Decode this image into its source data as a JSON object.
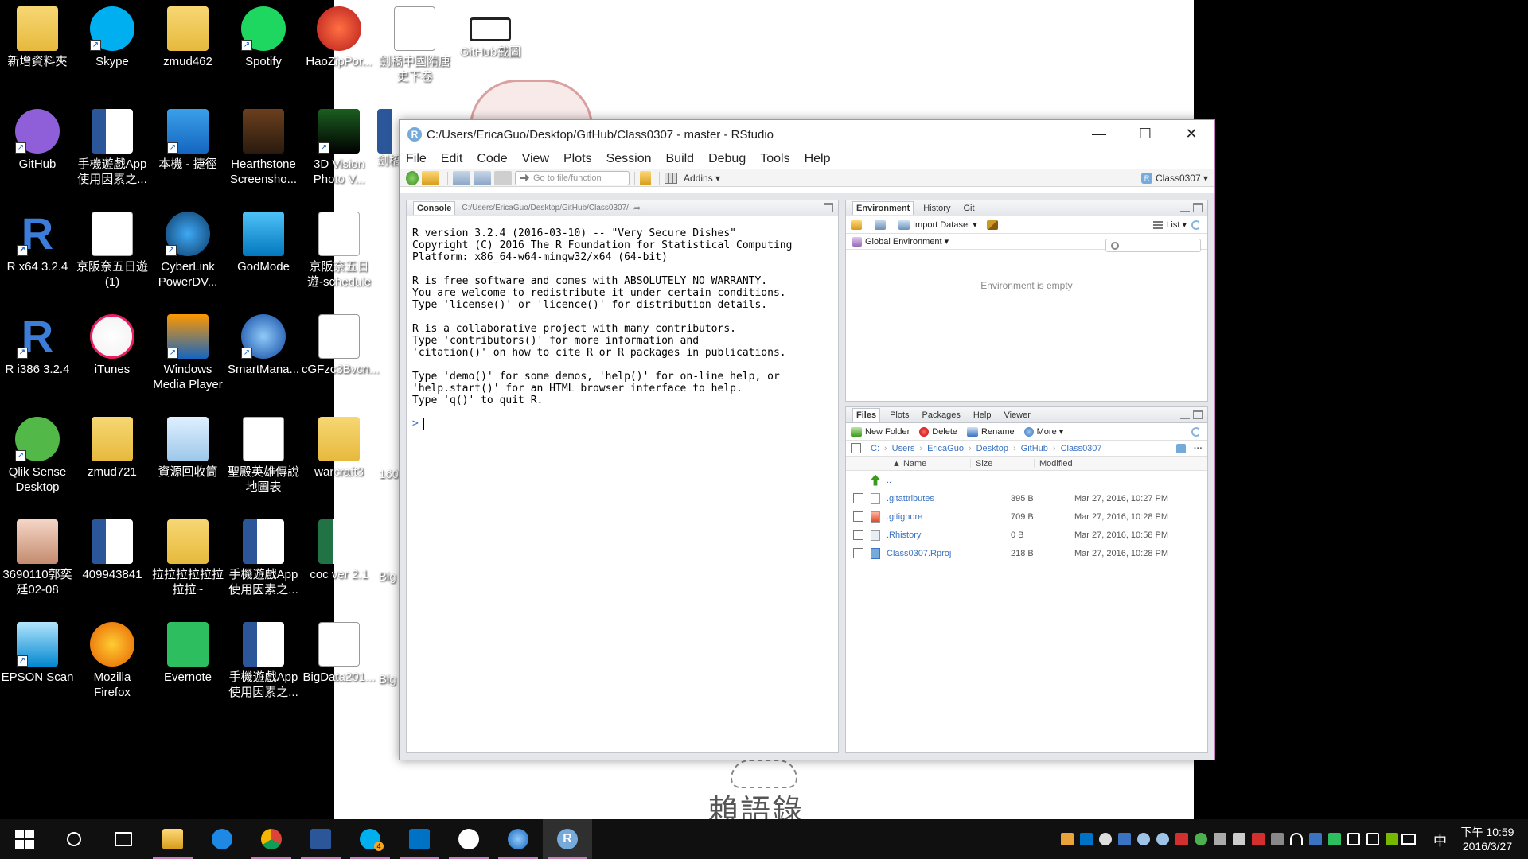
{
  "desktop": {
    "icons": [
      {
        "label": "新增資料夾",
        "icon": "folder-icon"
      },
      {
        "label": "Skype",
        "icon": "skype-icon"
      },
      {
        "label": "zmud462",
        "icon": "folder-icon"
      },
      {
        "label": "Spotify",
        "icon": "spotify-icon"
      },
      {
        "label": "HaoZipPor...",
        "icon": "haozip-icon"
      },
      {
        "label": "劍橋中國隋唐史下卷",
        "icon": "pdf-icon"
      },
      {
        "label": "GitHub截圖",
        "icon": "screenshot-icon"
      },
      {
        "label": "GitHub",
        "icon": "github-icon"
      },
      {
        "label": "手機遊戲App使用因素之...",
        "icon": "word-icon"
      },
      {
        "label": "本機 - 捷徑",
        "icon": "this-pc-icon"
      },
      {
        "label": "Hearthstone Screensho...",
        "icon": "hearthstone-icon"
      },
      {
        "label": "3D Vision Photo V...",
        "icon": "3d-vision-icon"
      },
      {
        "label": "R x64 3.2.4",
        "icon": "r-icon"
      },
      {
        "label": "京阪奈五日遊 (1)",
        "icon": "document-icon"
      },
      {
        "label": "CyberLink PowerDV...",
        "icon": "cyberlink-icon"
      },
      {
        "label": "GodMode",
        "icon": "godmode-icon"
      },
      {
        "label": "京阪奈五日遊-schedule",
        "icon": "word-icon"
      },
      {
        "label": "R i386 3.2.4",
        "icon": "r-icon"
      },
      {
        "label": "iTunes",
        "icon": "itunes-icon"
      },
      {
        "label": "Windows Media Player",
        "icon": "wmp-icon"
      },
      {
        "label": "SmartMana...",
        "icon": "smartmanager-icon"
      },
      {
        "label": "cGFzc3Bvcn...",
        "icon": "pdf-icon"
      },
      {
        "label": "Qlik Sense Desktop",
        "icon": "qlik-icon"
      },
      {
        "label": "zmud721",
        "icon": "folder-icon"
      },
      {
        "label": "資源回收筒",
        "icon": "recycle-bin-icon"
      },
      {
        "label": "聖殿英雄傳說地圖表",
        "icon": "document-icon"
      },
      {
        "label": "warcraft3",
        "icon": "folder-icon"
      },
      {
        "label": "3690110郭奕廷02-08",
        "icon": "photo-icon"
      },
      {
        "label": "409943841",
        "icon": "word-icon"
      },
      {
        "label": "拉拉拉拉拉拉拉拉~",
        "icon": "folder-icon"
      },
      {
        "label": "手機遊戲App使用因素之...",
        "icon": "word-icon"
      },
      {
        "label": "coc ver 2.1",
        "icon": "excel-icon"
      },
      {
        "label": "EPSON Scan",
        "icon": "epson-icon"
      },
      {
        "label": "Mozilla Firefox",
        "icon": "firefox-icon"
      },
      {
        "label": "Evernote",
        "icon": "evernote-icon"
      },
      {
        "label": "手機遊戲App使用因素之...",
        "icon": "word-icon"
      },
      {
        "label": "BigData201...",
        "icon": "pdf-icon"
      }
    ],
    "partial_labels": [
      "劍橋",
      "160",
      "Big",
      "Big"
    ]
  },
  "rstudio": {
    "title": "C:/Users/EricaGuo/Desktop/GitHub/Class0307 - master - RStudio",
    "menu": [
      "File",
      "Edit",
      "Code",
      "View",
      "Plots",
      "Session",
      "Build",
      "Debug",
      "Tools",
      "Help"
    ],
    "toolbar": {
      "goto_placeholder": "Go to file/function",
      "addins_label": "Addins ▾",
      "project_label": "Class0307 ▾"
    },
    "console": {
      "tab_label": "Console",
      "path": "C:/Users/EricaGuo/Desktop/GitHub/Class0307/",
      "output": "R version 3.2.4 (2016-03-10) -- \"Very Secure Dishes\"\nCopyright (C) 2016 The R Foundation for Statistical Computing\nPlatform: x86_64-w64-mingw32/x64 (64-bit)\n\nR is free software and comes with ABSOLUTELY NO WARRANTY.\nYou are welcome to redistribute it under certain conditions.\nType 'license()' or 'licence()' for distribution details.\n\nR is a collaborative project with many contributors.\nType 'contributors()' for more information and\n'citation()' on how to cite R or R packages in publications.\n\nType 'demo()' for some demos, 'help()' for on-line help, or\n'help.start()' for an HTML browser interface to help.\nType 'q()' to quit R.",
      "prompt": ">"
    },
    "env_pane": {
      "tabs": [
        "Environment",
        "History",
        "Git"
      ],
      "import_label": "Import Dataset ▾",
      "list_label": "List ▾",
      "scope_label": "Global Environment ▾",
      "empty_message": "Environment is empty"
    },
    "files_pane": {
      "tabs": [
        "Files",
        "Plots",
        "Packages",
        "Help",
        "Viewer"
      ],
      "actions": {
        "new_folder": "New Folder",
        "delete": "Delete",
        "rename": "Rename",
        "more": "More ▾"
      },
      "breadcrumb": [
        "C:",
        "Users",
        "EricaGuo",
        "Desktop",
        "GitHub",
        "Class0307"
      ],
      "columns": {
        "name": "▲ Name",
        "size": "Size",
        "modified": "Modified"
      },
      "parent_label": "..",
      "files": [
        {
          "name": ".gitattributes",
          "size": "395 B",
          "modified": "Mar 27, 2016, 10:27 PM",
          "icon": "text-file-icon"
        },
        {
          "name": ".gitignore",
          "size": "709 B",
          "modified": "Mar 27, 2016, 10:28 PM",
          "icon": "gitignore-file-icon"
        },
        {
          "name": ".Rhistory",
          "size": "0 B",
          "modified": "Mar 27, 2016, 10:58 PM",
          "icon": "rhistory-file-icon"
        },
        {
          "name": "Class0307.Rproj",
          "size": "218 B",
          "modified": "Mar 27, 2016, 10:28 PM",
          "icon": "rproj-file-icon"
        }
      ]
    }
  },
  "wallpaper": {
    "caption": "賴語錄"
  },
  "taskbar": {
    "ime": "中",
    "time": "下午 10:59",
    "date": "2016/3/27",
    "skype_badge": "4"
  }
}
